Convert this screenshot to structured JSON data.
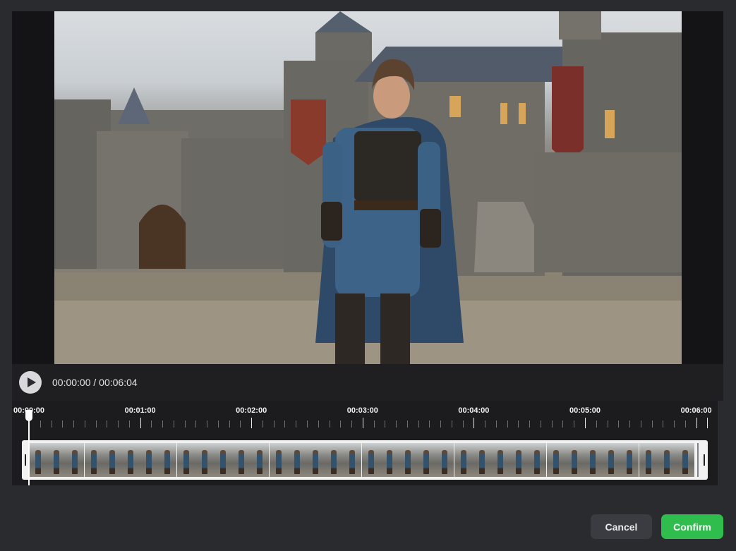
{
  "player": {
    "current_time": "00:00:00",
    "separator": "/",
    "total_time": "00:06:04"
  },
  "timeline": {
    "tick_labels": [
      "00:00:00",
      "00:01:00",
      "00:02:00",
      "00:03:00",
      "00:04:00",
      "00:05:00",
      "00:06:00"
    ],
    "playhead_position_seconds": 0,
    "duration_seconds": 364,
    "thumbnail_count": 36
  },
  "buttons": {
    "cancel_label": "Cancel",
    "confirm_label": "Confirm"
  },
  "colors": {
    "confirm_accent": "#2fbe4e",
    "background": "#2a2b2f"
  }
}
